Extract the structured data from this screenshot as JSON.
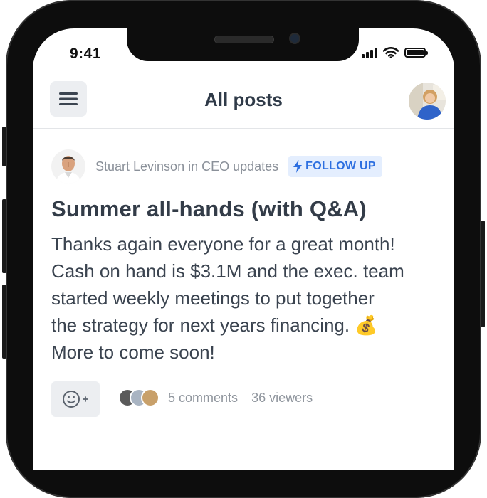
{
  "status_bar": {
    "time": "9:41"
  },
  "header": {
    "title": "All posts"
  },
  "post": {
    "author": "Stuart Levinson in CEO updates",
    "tag": "FOLLOW UP",
    "title": "Summer all-hands (with Q&A)",
    "body_lines": [
      "Thanks again everyone for a great month!",
      "Cash on hand is $3.1M and the exec. team",
      "started weekly meetings to put together",
      "the strategy for next years financing. 💰",
      "More to come soon!"
    ],
    "comments": "5 comments",
    "viewers": "36 viewers"
  },
  "icons": {
    "menu": "hamburger-icon",
    "tag": "lightning-icon",
    "reaction": "add-reaction-icon",
    "status": [
      "signal-icon",
      "wifi-icon",
      "battery-icon"
    ]
  },
  "colors": {
    "accent": "#2d6fe0",
    "tag_bg": "#e4eefe",
    "title": "#333c48",
    "button_bg": "#eceef1"
  }
}
